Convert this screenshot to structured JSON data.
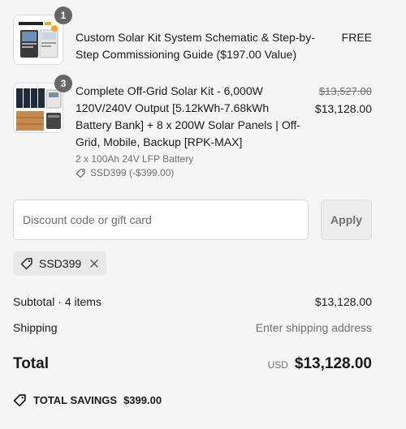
{
  "items": [
    {
      "quantity": "1",
      "title": "Custom Solar Kit System Schematic & Step-by-Step Commissioning Guide ($197.00 Value)",
      "price": "FREE",
      "thumbnail_icon": "solar-guide-thumbnail"
    },
    {
      "quantity": "3",
      "title": "Complete Off-Grid Solar Kit - 6,000W 120V/240V Output [5.12kWh-7.68kWh Battery Bank] + 8 x 200W Solar Panels | Off-Grid, Mobile, Backup [RPK-MAX]",
      "original_price": "$13,527.00",
      "price": "$13,128.00",
      "variant": "2 x 100Ah 24V LFP Battery",
      "discount": "SSD399 (-$399.00)",
      "thumbnail_icon": "solar-kit-thumbnail"
    }
  ],
  "discount_form": {
    "placeholder": "Discount code or gift card",
    "apply_label": "Apply"
  },
  "applied_code": "SSD399",
  "summary": {
    "subtotal_label": "Subtotal · 4 items",
    "subtotal_value": "$13,128.00",
    "shipping_label": "Shipping",
    "shipping_value": "Enter shipping address",
    "total_label": "Total",
    "currency": "USD",
    "total_value": "$13,128.00",
    "savings_label": "TOTAL SAVINGS",
    "savings_value": "$399.00"
  },
  "colors": {
    "background": "#f5f5f5",
    "muted_text": "#707070",
    "badge": "#666666"
  }
}
